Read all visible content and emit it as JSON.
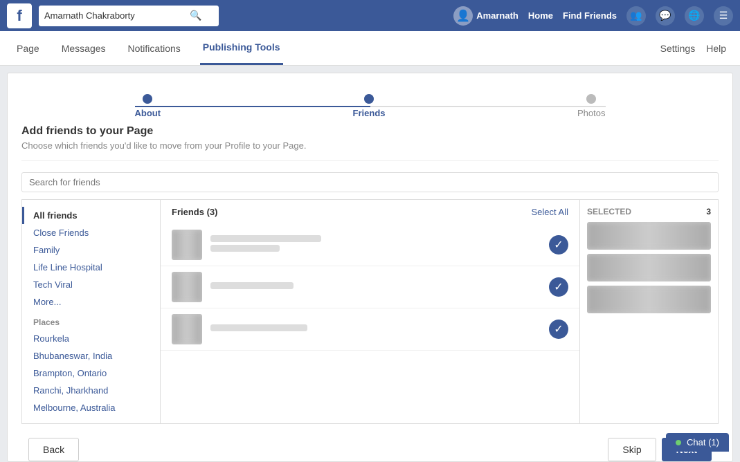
{
  "topNav": {
    "logoText": "f",
    "searchPlaceholder": "Amarnath Chakraborty",
    "userName": "Amarnath",
    "navLinks": [
      "Home",
      "Find Friends"
    ]
  },
  "subNav": {
    "items": [
      "Page",
      "Messages",
      "Notifications",
      "Publishing Tools"
    ],
    "activeItem": "Publishing Tools",
    "rightItems": [
      "Settings",
      "Help"
    ]
  },
  "progress": {
    "steps": [
      "About",
      "Friends",
      "Photos"
    ],
    "activeSteps": [
      0,
      1
    ]
  },
  "pageHeader": {
    "title": "Add friends to your Page",
    "subtitle": "Choose which friends you'd like to move from your Profile to your Page."
  },
  "searchBar": {
    "placeholder": "Search for friends"
  },
  "sidebar": {
    "activeItem": "All friends",
    "friendsGroups": [
      "All friends",
      "Close Friends",
      "Family",
      "Life Line Hospital",
      "Tech Viral",
      "More..."
    ],
    "placesLabel": "Places",
    "places": [
      "Rourkela",
      "Bhubaneswar, India",
      "Brampton, Ontario",
      "Ranchi, Jharkhand",
      "Melbourne, Australia"
    ]
  },
  "friendsList": {
    "header": "Friends (3)",
    "selectAllLabel": "Select All",
    "friends": [
      {
        "id": 1,
        "selected": true
      },
      {
        "id": 2,
        "selected": true
      },
      {
        "id": 3,
        "selected": true
      }
    ]
  },
  "selected": {
    "label": "SELECTED",
    "count": "3",
    "items": [
      1,
      2,
      3
    ]
  },
  "buttons": {
    "back": "Back",
    "skip": "Skip",
    "next": "Next"
  },
  "chat": {
    "label": "Chat (1)"
  }
}
